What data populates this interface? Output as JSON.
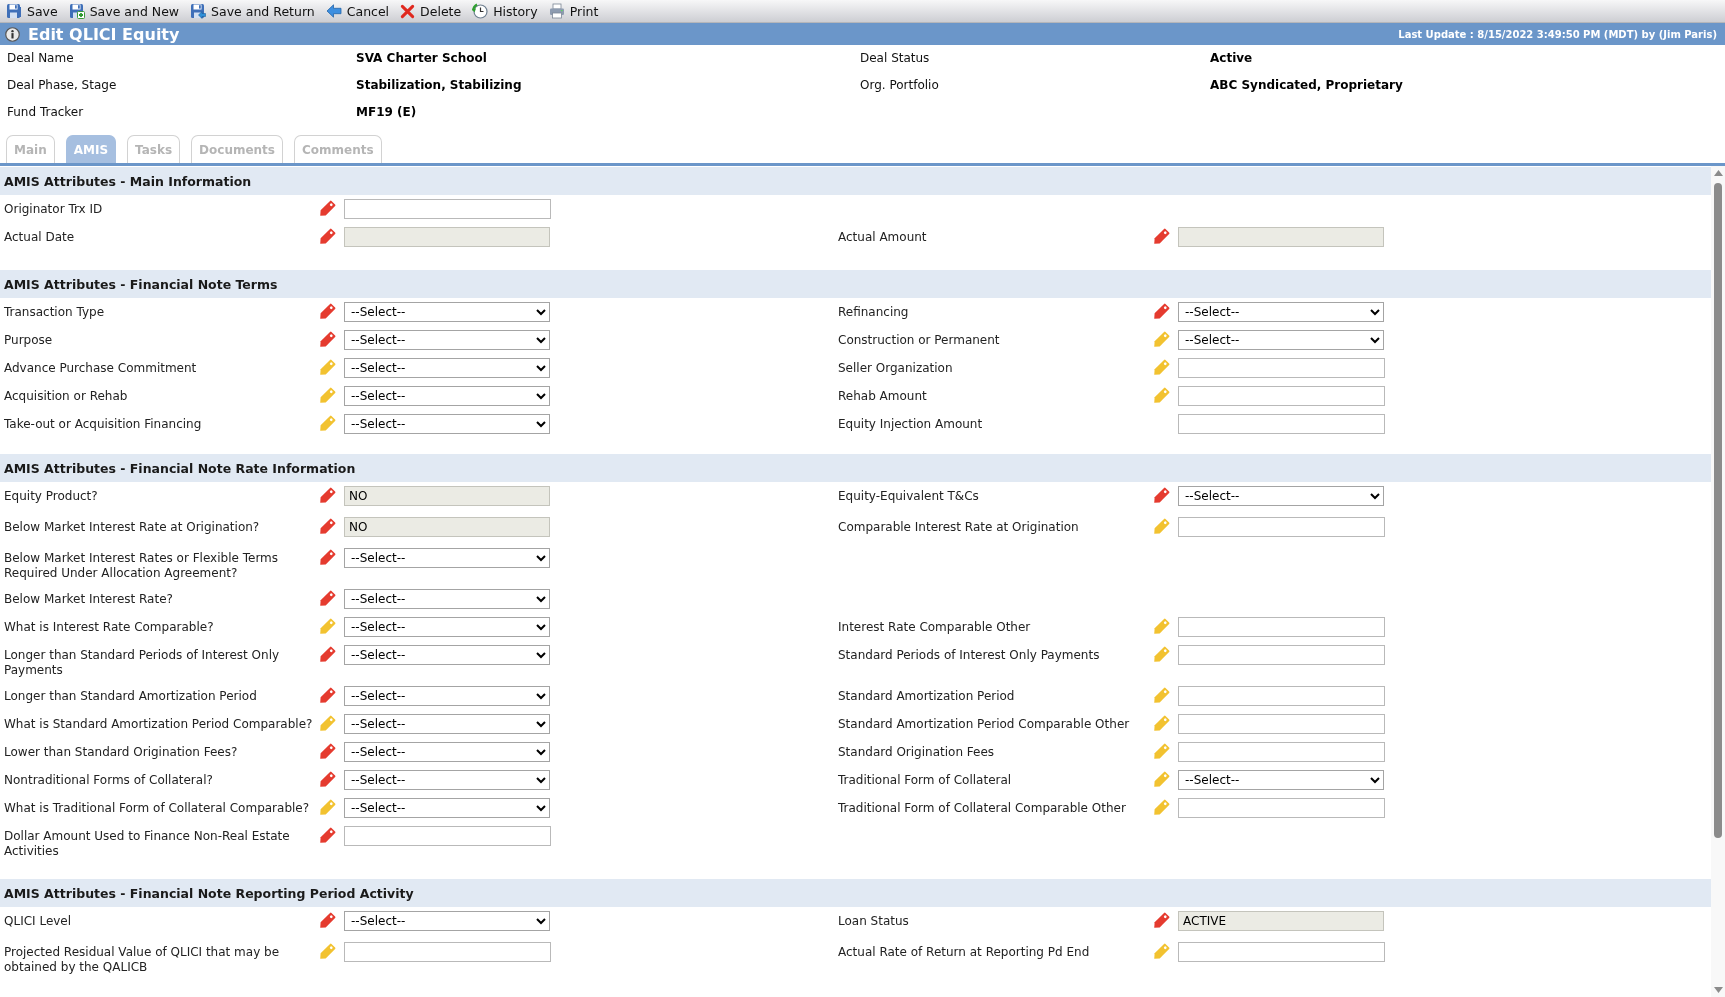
{
  "toolbar": [
    {
      "kind": "save",
      "label": "Save"
    },
    {
      "kind": "save_new",
      "label": "Save and New"
    },
    {
      "kind": "save_return",
      "label": "Save and Return"
    },
    {
      "kind": "cancel",
      "label": "Cancel"
    },
    {
      "kind": "delete",
      "label": "Delete"
    },
    {
      "kind": "history",
      "label": "History"
    },
    {
      "kind": "print",
      "label": "Print"
    }
  ],
  "title_bar": {
    "title": "Edit QLICI Equity",
    "last_update": "Last Update : 8/15/2022 3:49:50 PM (MDT) by (Jim Paris)"
  },
  "deal_info": [
    {
      "left": {
        "label": "Deal Name",
        "value": "SVA Charter School"
      },
      "right": {
        "label": "Deal Status",
        "value": "Active"
      }
    },
    {
      "left": {
        "label": "Deal Phase, Stage",
        "value": "Stabilization, Stabilizing"
      },
      "right": {
        "label": "Org. Portfolio",
        "value": "ABC Syndicated, Proprietary"
      }
    },
    {
      "left": {
        "label": "Fund Tracker",
        "value": "MF19 (E)"
      }
    }
  ],
  "tabs": [
    {
      "label": "Main",
      "selected": false
    },
    {
      "label": "AMIS",
      "selected": true
    },
    {
      "label": "Tasks",
      "selected": false
    },
    {
      "label": "Documents",
      "selected": false
    },
    {
      "label": "Comments",
      "selected": false
    }
  ],
  "sections": [
    {
      "title": "AMIS Attributes - Main Information",
      "rows": [
        {
          "left": {
            "label": "Originator Trx ID",
            "color": "#e53b2f",
            "kind": "text"
          }
        },
        {
          "left": {
            "label": "Actual Date",
            "color": "#e53b2f",
            "kind": "readonly"
          },
          "right": {
            "label": "Actual Amount",
            "color": "#e53b2f",
            "kind": "readonly"
          }
        }
      ]
    },
    {
      "title": "AMIS Attributes - Financial Note Terms",
      "rows": [
        {
          "left": {
            "label": "Transaction Type",
            "color": "#e53b2f",
            "kind": "select",
            "value": "--Select--"
          },
          "right": {
            "label": "Refinancing",
            "color": "#e53b2f",
            "kind": "select",
            "value": "--Select--"
          }
        },
        {
          "left": {
            "label": "Purpose",
            "color": "#e53b2f",
            "kind": "select",
            "value": "--Select--"
          },
          "right": {
            "label": "Construction or Permanent",
            "color": "#f2c230",
            "kind": "select",
            "value": "--Select--"
          }
        },
        {
          "left": {
            "label": "Advance Purchase Commitment",
            "color": "#f2c230",
            "kind": "select",
            "value": "--Select--"
          },
          "right": {
            "label": "Seller Organization",
            "color": "#f2c230",
            "kind": "text"
          }
        },
        {
          "left": {
            "label": "Acquisition or Rehab",
            "color": "#f2c230",
            "kind": "select",
            "value": "--Select--"
          },
          "right": {
            "label": "Rehab Amount",
            "color": "#f2c230",
            "kind": "text"
          }
        },
        {
          "left": {
            "label": "Take-out or Acquisition Financing",
            "color": "#f2c230",
            "kind": "select",
            "value": "--Select--"
          },
          "right": {
            "label": "Equity Injection Amount",
            "kind": "text"
          }
        }
      ]
    },
    {
      "title": "AMIS Attributes - Financial Note Rate Information",
      "rows": [
        {
          "left": {
            "label": "Equity Product?",
            "color": "#e53b2f",
            "kind": "readonly",
            "value": "NO"
          },
          "right": {
            "label": "Equity-Equivalent T&Cs",
            "color": "#e53b2f",
            "kind": "select",
            "value": "--Select--"
          }
        },
        {
          "left": {
            "label": "Below Market Interest Rate at Origination?",
            "color": "#e53b2f",
            "kind": "readonly",
            "value": "NO"
          },
          "right": {
            "label": "Comparable Interest Rate at Origination",
            "color": "#f2c230",
            "kind": "text"
          }
        },
        {
          "left": {
            "label": "Below Market Interest Rates or Flexible Terms Required Under Allocation Agreement?",
            "color": "#e53b2f",
            "kind": "select",
            "value": "--Select--"
          }
        },
        {
          "left": {
            "label": "Below Market Interest Rate?",
            "color": "#e53b2f",
            "kind": "select",
            "value": "--Select--"
          }
        },
        {
          "left": {
            "label": "What is Interest Rate Comparable?",
            "color": "#f2c230",
            "kind": "select",
            "value": "--Select--"
          },
          "right": {
            "label": "Interest Rate Comparable Other",
            "color": "#f2c230",
            "kind": "text"
          }
        },
        {
          "left": {
            "label": "Longer than Standard Periods of Interest Only Payments",
            "color": "#e53b2f",
            "kind": "select",
            "value": "--Select--"
          },
          "right": {
            "label": "Standard Periods of Interest Only Payments",
            "color": "#f2c230",
            "kind": "text"
          }
        },
        {
          "left": {
            "label": "Longer than Standard Amortization Period",
            "color": "#e53b2f",
            "kind": "select",
            "value": "--Select--"
          },
          "right": {
            "label": "Standard Amortization Period",
            "color": "#f2c230",
            "kind": "text"
          }
        },
        {
          "left": {
            "label": "What is Standard Amortization Period Comparable?",
            "color": "#f2c230",
            "kind": "select",
            "value": "--Select--"
          },
          "right": {
            "label": "Standard Amortization Period Comparable Other",
            "color": "#f2c230",
            "kind": "text"
          }
        },
        {
          "left": {
            "label": "Lower than Standard Origination Fees?",
            "color": "#e53b2f",
            "kind": "select",
            "value": "--Select--"
          },
          "right": {
            "label": "Standard Origination Fees",
            "color": "#f2c230",
            "kind": "text"
          }
        },
        {
          "left": {
            "label": "Nontraditional Forms of Collateral?",
            "color": "#e53b2f",
            "kind": "select",
            "value": "--Select--"
          },
          "right": {
            "label": "Traditional Form of Collateral",
            "color": "#f2c230",
            "kind": "select",
            "value": "--Select--"
          }
        },
        {
          "left": {
            "label": "What is Traditional Form of Collateral Comparable?",
            "color": "#f2c230",
            "kind": "select",
            "value": "--Select--"
          },
          "right": {
            "label": "Traditional Form of Collateral Comparable Other",
            "color": "#f2c230",
            "kind": "text"
          }
        },
        {
          "left": {
            "label": "Dollar Amount Used to Finance Non-Real Estate Activities",
            "color": "#e53b2f",
            "kind": "text"
          }
        }
      ]
    },
    {
      "title": "AMIS Attributes - Financial Note Reporting Period Activity",
      "rows": [
        {
          "left": {
            "label": "QLICI Level",
            "color": "#e53b2f",
            "kind": "select",
            "value": "--Select--"
          },
          "right": {
            "label": "Loan Status",
            "color": "#e53b2f",
            "kind": "readonly",
            "value": "ACTIVE"
          }
        },
        {
          "left": {
            "label": "Projected Residual Value of QLICI that may be obtained by the QALICB",
            "color": "#f2c230",
            "kind": "text"
          },
          "right": {
            "label": "Actual Rate of Return at Reporting Pd End",
            "color": "#f2c230",
            "kind": "text"
          }
        }
      ]
    }
  ]
}
